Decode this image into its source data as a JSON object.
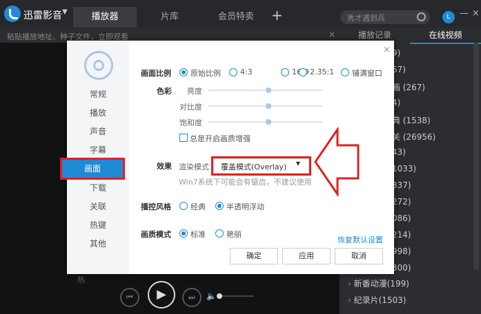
{
  "app": {
    "name": "迅雷影音"
  },
  "tabs": [
    "播放器",
    "片库",
    "会员特卖"
  ],
  "search": {
    "placeholder": "秀才遇到兵"
  },
  "subbar": {
    "hint": "粘贴播放地址、种子文件，立即观看"
  },
  "right_panel": {
    "tabs": [
      "播放记录",
      "在线视频"
    ],
    "items": [
      {
        "label": "9)"
      },
      {
        "label": "67)"
      },
      {
        "label": "画 (267)"
      },
      {
        "label": "4)"
      },
      {
        "label": "典 (1538)"
      },
      {
        "label": "关 (26956)"
      },
      {
        "label": "43)"
      },
      {
        "label": "1033)"
      },
      {
        "label": "337)"
      },
      {
        "label": "272)"
      },
      {
        "label": "086)"
      },
      {
        "label": "214)"
      },
      {
        "label": "998)"
      },
      {
        "label": "300)"
      },
      {
        "label": "新番动漫(199)"
      },
      {
        "label": "纪录片(1503)"
      }
    ]
  },
  "dialog": {
    "sidebar": [
      "常规",
      "播放",
      "声音",
      "字幕",
      "画面",
      "下载",
      "关联",
      "热键",
      "其他"
    ],
    "active_sidebar": "画面",
    "aspect": {
      "label": "画面比例",
      "options": [
        "原始比例",
        "4:3",
        "16:9",
        "2.35:1",
        "铺满窗口"
      ],
      "selected": "原始比例"
    },
    "color": {
      "label": "色彩",
      "sliders": [
        {
          "label": "亮度",
          "value": 0.5
        },
        {
          "label": "对比度",
          "value": 0.5
        },
        {
          "label": "饱和度",
          "value": 0.5
        }
      ],
      "enhance_label": "总是开启画质增强",
      "enhance_checked": false
    },
    "effect": {
      "label": "效果",
      "render_label": "渲染模式",
      "render_value": "覆盖模式(Overlay)",
      "hint": "Win7系统下可能会有锯齿，不建议使用"
    },
    "control_style": {
      "label": "播控风格",
      "options": [
        "经典",
        "半透明浮动"
      ],
      "selected": "半透明浮动"
    },
    "quality": {
      "label": "画质模式",
      "options": [
        "标准",
        "艳丽"
      ],
      "selected": "标准"
    },
    "restore_link": "恢复默认设置",
    "buttons": [
      "确定",
      "应用",
      "取消"
    ]
  },
  "bottom_left_fragment": "热",
  "colors": {
    "accent": "#1f8ad6",
    "highlight": "#e02020"
  }
}
